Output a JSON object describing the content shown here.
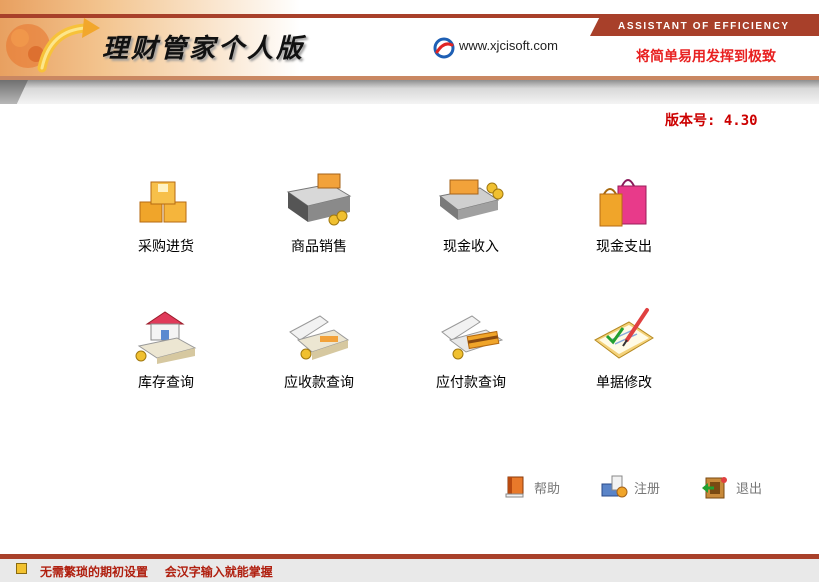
{
  "header": {
    "title": "理财管家个人版",
    "url": "www.xjcisoft.com",
    "tagline_en": "ASSISTANT OF EFFICIENCY",
    "slogan": "将简单易用发挥到极致"
  },
  "version": "版本号: 4.30",
  "functions": [
    {
      "label": "采购进货",
      "icon": "boxes-icon"
    },
    {
      "label": "商品销售",
      "icon": "cash-register-icon"
    },
    {
      "label": "现金收入",
      "icon": "cash-in-icon"
    },
    {
      "label": "现金支出",
      "icon": "shopping-bags-icon"
    },
    {
      "label": "库存查询",
      "icon": "warehouse-icon"
    },
    {
      "label": "应收款查询",
      "icon": "receivable-icon"
    },
    {
      "label": "应付款查询",
      "icon": "payable-icon"
    },
    {
      "label": "单据修改",
      "icon": "edit-document-icon"
    }
  ],
  "bottom_buttons": {
    "help": "帮助",
    "register": "注册",
    "exit": "退出"
  },
  "status": "无需繁琐的期初设置    会汉字输入就能掌握",
  "colors": {
    "brand": "#a8402a",
    "accent_red": "#e82020",
    "version_red": "#cc0000",
    "status_text": "#b02010"
  }
}
